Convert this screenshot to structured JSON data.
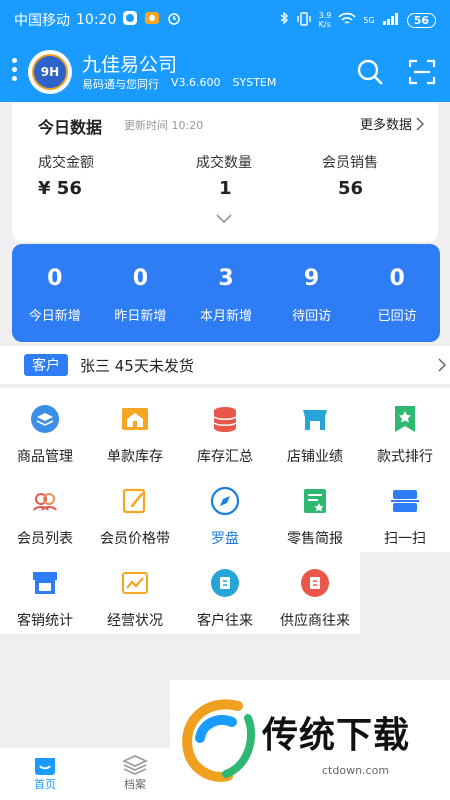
{
  "status": {
    "carrier": "中国移动",
    "time": "10:20",
    "net_speed_top": "3.9",
    "net_speed_bottom": "K/s",
    "signal_type": "5G",
    "battery": "56"
  },
  "header": {
    "company": "九佳易公司",
    "slogan": "易码通与您同行",
    "version": "V3.6.600",
    "mode": "SYSTEM",
    "logo_text": "9H"
  },
  "summary": {
    "title": "今日数据",
    "update_label": "更新时间 10:20",
    "more_label": "更多数据",
    "metrics": [
      {
        "label": "成交金额",
        "value": "¥ 56"
      },
      {
        "label": "成交数量",
        "value": "1"
      },
      {
        "label": "会员销售",
        "value": "56"
      }
    ]
  },
  "stats": [
    {
      "num": "0",
      "label": "今日新增"
    },
    {
      "num": "0",
      "label": "昨日新增"
    },
    {
      "num": "3",
      "label": "本月新增"
    },
    {
      "num": "9",
      "label": "待回访"
    },
    {
      "num": "0",
      "label": "已回访"
    }
  ],
  "notice": {
    "tag": "客户",
    "text": "张三 45天未发货"
  },
  "grid": [
    [
      {
        "label": "商品管理",
        "icon": "layers-icon"
      },
      {
        "label": "单款库存",
        "icon": "store-icon"
      },
      {
        "label": "库存汇总",
        "icon": "database-icon"
      },
      {
        "label": "店铺业绩",
        "icon": "shop-icon"
      },
      {
        "label": "款式排行",
        "icon": "bookmark-star-icon"
      }
    ],
    [
      {
        "label": "会员列表",
        "icon": "members-icon"
      },
      {
        "label": "会员价格带",
        "icon": "edit-icon"
      },
      {
        "label": "罗盘",
        "icon": "compass-icon"
      },
      {
        "label": "零售简报",
        "icon": "report-icon"
      },
      {
        "label": "扫一扫",
        "icon": "scan-icon"
      }
    ],
    [
      {
        "label": "客销统计",
        "icon": "stall-icon"
      },
      {
        "label": "经营状况",
        "icon": "trend-icon"
      },
      {
        "label": "客户往来",
        "icon": "customer-icon"
      },
      {
        "label": "供应商往来",
        "icon": "supplier-icon"
      }
    ]
  ],
  "tabs": [
    {
      "label": "首页",
      "icon": "home-icon"
    },
    {
      "label": "档案",
      "icon": "archive-icon"
    }
  ],
  "watermark": {
    "text": "传统下载",
    "url": "ctdown.com"
  },
  "colors": {
    "primary": "#1a9bff",
    "card_blue": "#2f7df5",
    "compass_label": "#1a7fe0"
  }
}
